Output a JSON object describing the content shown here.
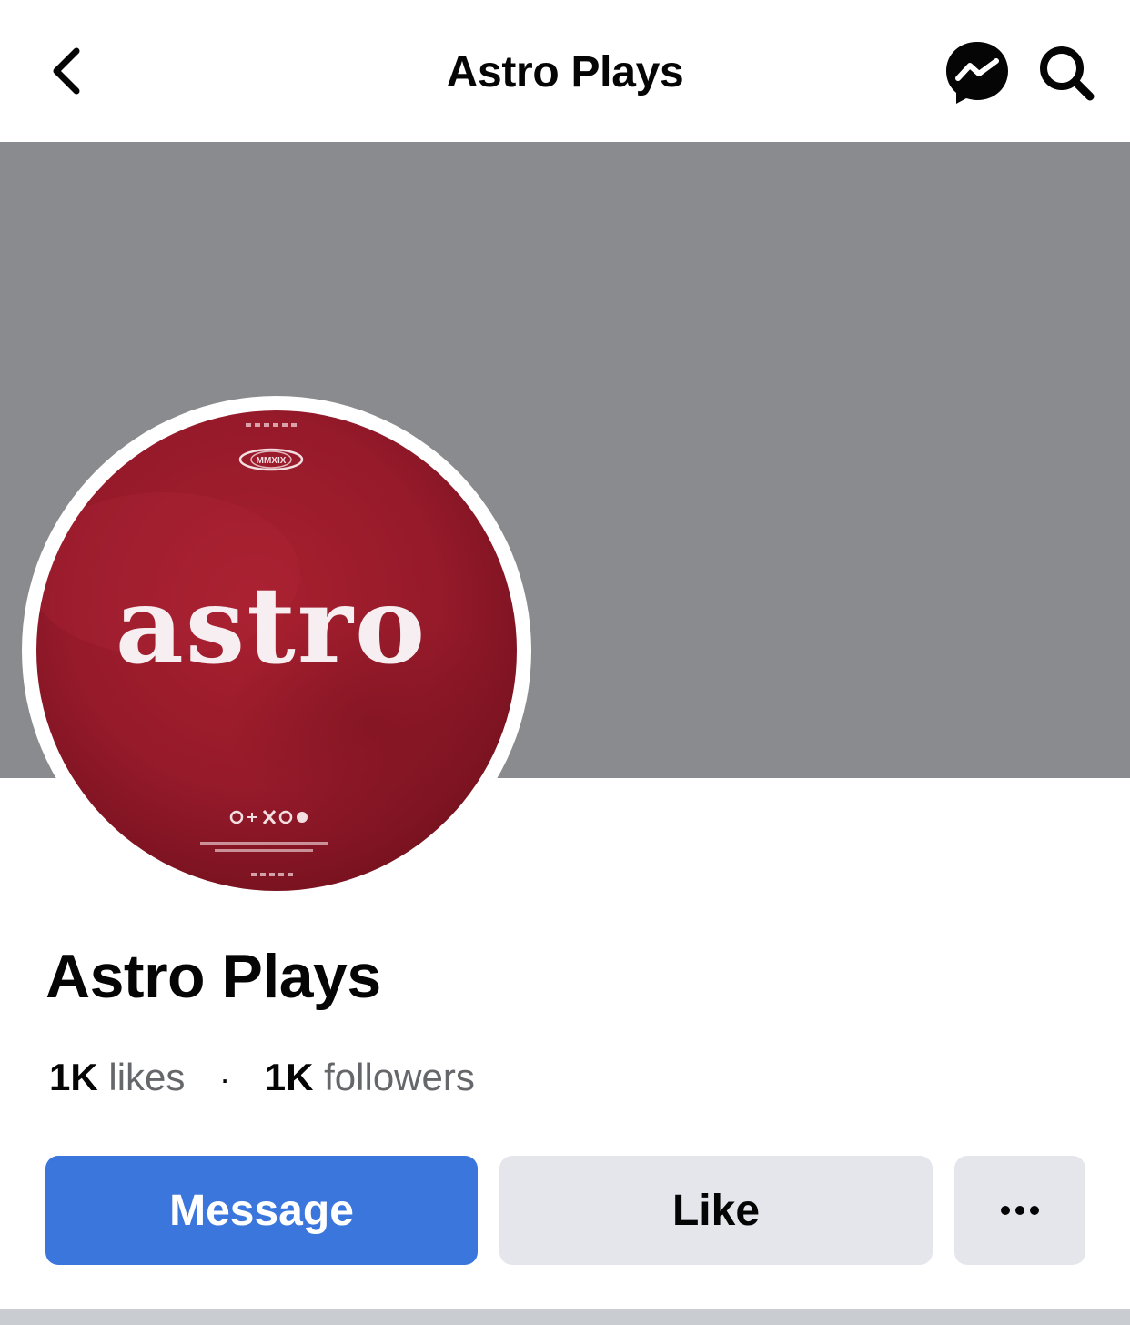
{
  "header": {
    "title": "Astro Plays",
    "back_icon": "chevron-left-icon",
    "messenger_icon": "messenger-icon",
    "search_icon": "search-icon"
  },
  "cover": {
    "color": "#8a8b8e"
  },
  "avatar": {
    "logo_text": "astro",
    "badge_text": "MMXIX",
    "background": "#9e1b2c"
  },
  "profile": {
    "name": "Astro Plays",
    "likes_count": "1K",
    "likes_label": "likes",
    "separator": "·",
    "followers_count": "1K",
    "followers_label": "followers"
  },
  "actions": {
    "message_label": "Message",
    "like_label": "Like",
    "more_label": "···",
    "message_color": "#3a76dc",
    "secondary_color": "#e4e6eb"
  }
}
